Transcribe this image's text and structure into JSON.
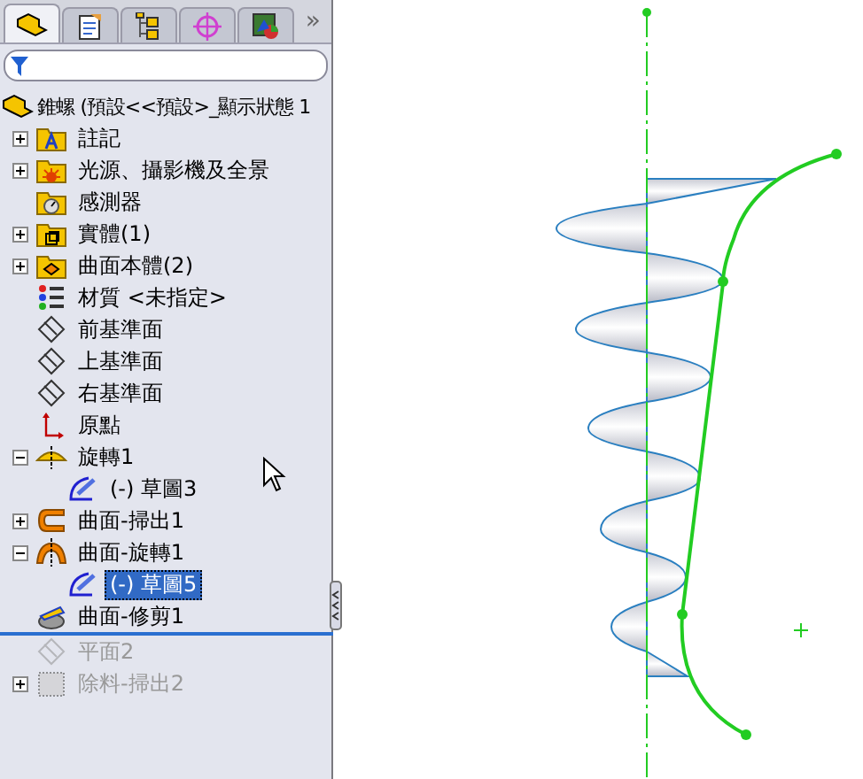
{
  "tabs": [
    {
      "kind": "tree",
      "selected": true
    },
    {
      "kind": "properties",
      "selected": false
    },
    {
      "kind": "config",
      "selected": false
    },
    {
      "kind": "target",
      "selected": false
    },
    {
      "kind": "display",
      "selected": false
    }
  ],
  "more": "»",
  "tree": {
    "label": "錐螺  (預設<<預設>_顯示狀態 1",
    "kind": "part",
    "children": [
      {
        "label": "註記",
        "kind": "annotations",
        "expandable": true,
        "expanded": false,
        "selected": false,
        "rolled_back": false
      },
      {
        "label": "光源、攝影機及全景",
        "kind": "lights",
        "expandable": true,
        "expanded": false,
        "selected": false,
        "rolled_back": false
      },
      {
        "label": "感測器",
        "kind": "sensors",
        "expandable": false,
        "selected": false,
        "rolled_back": false
      },
      {
        "label": "實體(1)",
        "kind": "solid-bodies",
        "expandable": true,
        "expanded": false,
        "selected": false,
        "rolled_back": false
      },
      {
        "label": "曲面本體(2)",
        "kind": "surface-bodies",
        "expandable": true,
        "expanded": false,
        "selected": false,
        "rolled_back": false
      },
      {
        "label": "材質 <未指定>",
        "kind": "material",
        "expandable": false,
        "selected": false,
        "rolled_back": false
      },
      {
        "label": "前基準面",
        "kind": "plane",
        "expandable": false,
        "selected": false,
        "rolled_back": false
      },
      {
        "label": "上基準面",
        "kind": "plane",
        "expandable": false,
        "selected": false,
        "rolled_back": false
      },
      {
        "label": "右基準面",
        "kind": "plane",
        "expandable": false,
        "selected": false,
        "rolled_back": false
      },
      {
        "label": "原點",
        "kind": "origin",
        "expandable": false,
        "selected": false,
        "rolled_back": false
      },
      {
        "label": "旋轉1",
        "kind": "revolve",
        "expandable": true,
        "expanded": true,
        "selected": false,
        "rolled_back": false,
        "children": [
          {
            "label": "(-) 草圖3",
            "kind": "sketch",
            "expandable": false,
            "selected": false,
            "rolled_back": false
          }
        ]
      },
      {
        "label": "曲面-掃出1",
        "kind": "sweep-surface",
        "expandable": true,
        "expanded": false,
        "selected": false,
        "rolled_back": false
      },
      {
        "label": "曲面-旋轉1",
        "kind": "revolve-surface",
        "expandable": true,
        "expanded": true,
        "selected": false,
        "rolled_back": false,
        "children": [
          {
            "label": "(-) 草圖5",
            "kind": "sketch",
            "expandable": false,
            "selected": true,
            "rolled_back": false
          }
        ]
      },
      {
        "label": "曲面-修剪1",
        "kind": "trim-surface",
        "expandable": false,
        "selected": false,
        "rolled_back": false
      },
      {
        "label": "平面2",
        "kind": "plane",
        "expandable": false,
        "selected": false,
        "rolled_back": true
      },
      {
        "label": "除料-掃出2",
        "kind": "cut-sweep",
        "expandable": true,
        "expanded": false,
        "selected": false,
        "rolled_back": true
      }
    ]
  }
}
